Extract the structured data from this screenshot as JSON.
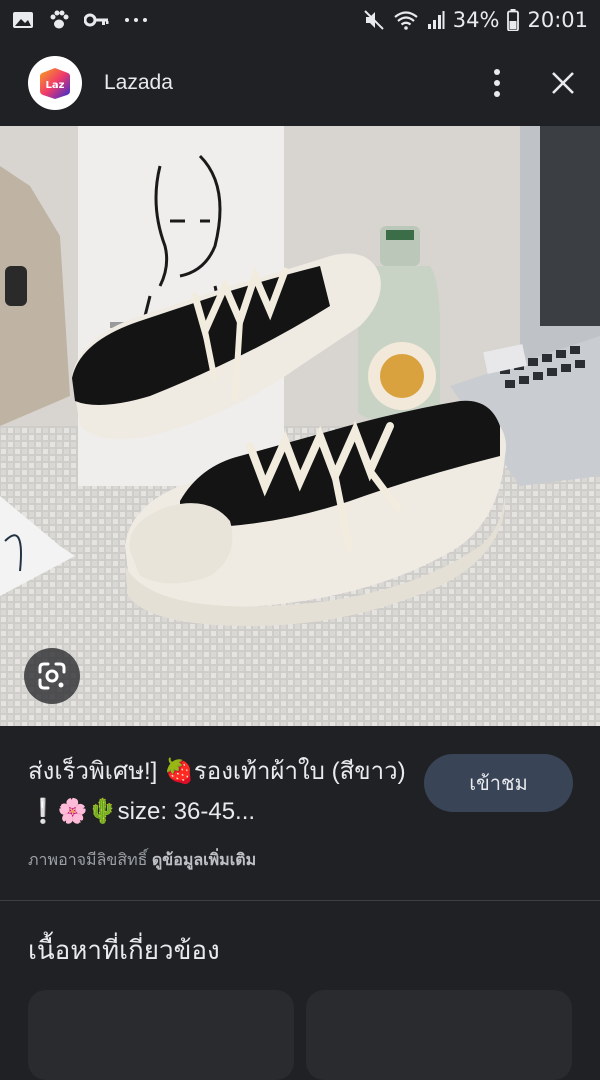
{
  "status_bar": {
    "battery": "34%",
    "time": "20:01",
    "icons": [
      "gallery-icon",
      "paw-icon",
      "key-icon",
      "more-dots-icon",
      "mute-icon",
      "wifi-icon",
      "signal-icon",
      "battery-icon"
    ]
  },
  "app_bar": {
    "logo_text": "Laz",
    "title": "Lazada",
    "actions": [
      "more-vert-icon",
      "close-icon"
    ]
  },
  "hero": {
    "lens_icon": "google-lens-icon"
  },
  "result": {
    "title": "ส่งเร็วพิเศษ!] 🍓รองเท้าผ้าใบ (สีขาว) ❕🌸🌵size: 36-45...",
    "visit_label": "เข้าชม",
    "copyright_text": "ภาพอาจมีลิขสิทธิ์",
    "more_info_label": "ดูข้อมูลเพิ่มเติม"
  },
  "related": {
    "heading": "เนื้อหาที่เกี่ยวข้อง"
  },
  "colors": {
    "background": "#202124",
    "button": "#394457",
    "accent_lazada": "#f36f21"
  }
}
